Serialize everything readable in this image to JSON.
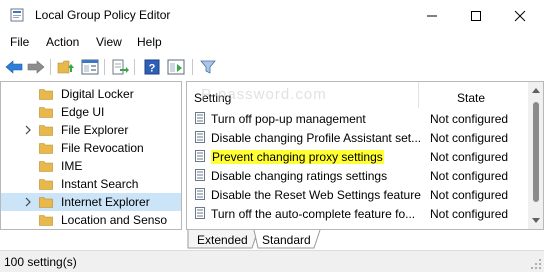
{
  "window": {
    "title": "Local Group Policy Editor",
    "icon": "gpedit-icon",
    "controls": [
      "minimize-icon",
      "maximize-icon",
      "close-icon"
    ]
  },
  "menu": {
    "items": [
      "File",
      "Action",
      "View",
      "Help"
    ]
  },
  "toolbar": {
    "icons": [
      "back-arrow-icon",
      "forward-arrow-icon",
      "up-folder-icon",
      "show-hide-tree-icon",
      "export-list-icon",
      "help-icon",
      "extended-view-icon",
      "filter-icon"
    ]
  },
  "tree": {
    "items": [
      {
        "label": "Digital Locker",
        "expandable": false,
        "selected": false
      },
      {
        "label": "Edge UI",
        "expandable": false,
        "selected": false
      },
      {
        "label": "File Explorer",
        "expandable": true,
        "selected": false
      },
      {
        "label": "File Revocation",
        "expandable": false,
        "selected": false
      },
      {
        "label": "IME",
        "expandable": false,
        "selected": false
      },
      {
        "label": "Instant Search",
        "expandable": false,
        "selected": false
      },
      {
        "label": "Internet Explorer",
        "expandable": true,
        "selected": true
      },
      {
        "label": "Location and Senso",
        "expandable": false,
        "selected": false
      }
    ]
  },
  "list": {
    "columns": {
      "setting": "Setting",
      "state": "State"
    },
    "rows": [
      {
        "setting": "Turn off pop-up management",
        "state": "Not configured",
        "highlighted": false
      },
      {
        "setting": "Disable changing Profile Assistant set...",
        "state": "Not configured",
        "highlighted": false
      },
      {
        "setting": "Prevent changing proxy settings",
        "state": "Not configured",
        "highlighted": true
      },
      {
        "setting": "Disable changing ratings settings",
        "state": "Not configured",
        "highlighted": false
      },
      {
        "setting": "Disable the Reset Web Settings feature",
        "state": "Not configured",
        "highlighted": false
      },
      {
        "setting": "Turn off the auto-complete feature fo...",
        "state": "Not configured",
        "highlighted": false
      }
    ],
    "watermark": "P-password.com",
    "highlight_color": "#ffff33"
  },
  "tabs": {
    "items": [
      "Extended",
      "Standard"
    ],
    "active": "Standard"
  },
  "status": {
    "text": "100 setting(s)"
  },
  "colors": {
    "accent": "#1f6fcf",
    "selection": "#cce4f7",
    "folder": "#e8b84a"
  }
}
